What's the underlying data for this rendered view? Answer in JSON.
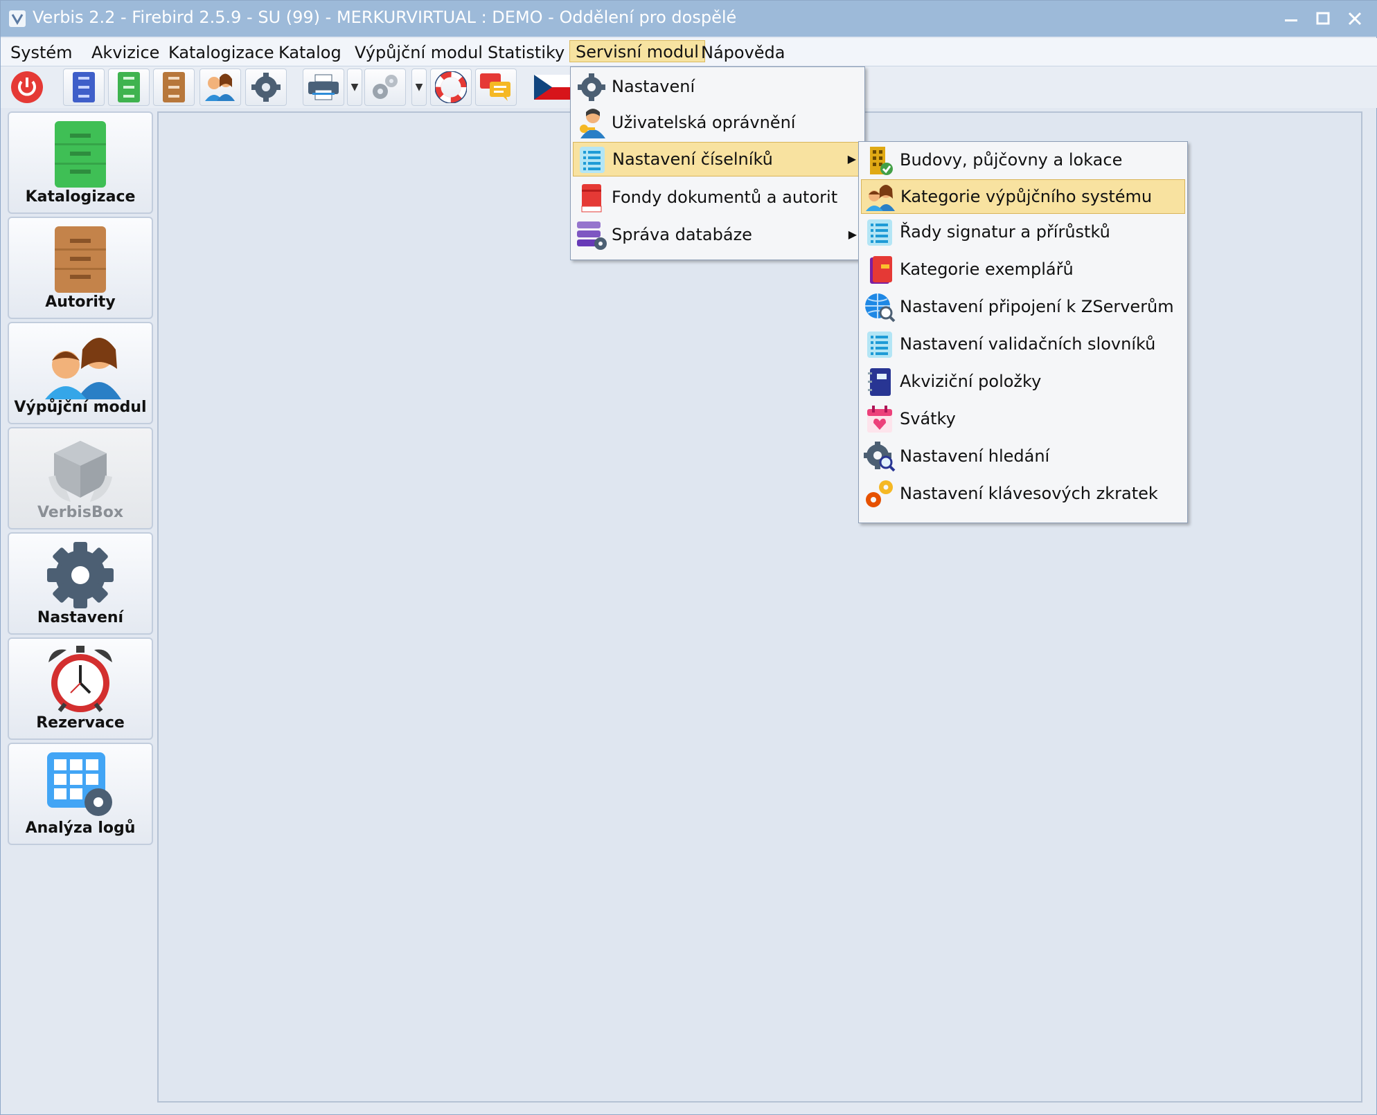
{
  "window": {
    "title": "Verbis 2.2 - Firebird 2.5.9 - SU (99) - MERKURVIRTUAL : DEMO - Oddělení pro dospělé"
  },
  "menubar": [
    {
      "label": "Systém"
    },
    {
      "label": "Akvizice"
    },
    {
      "label": "Katalogizace"
    },
    {
      "label": "Katalog"
    },
    {
      "label": "Výpůjční modul"
    },
    {
      "label": "Statistiky"
    },
    {
      "label": "Servisní modul"
    },
    {
      "label": "Nápověda"
    }
  ],
  "active_menu": "Servisní modul",
  "toolbar": {
    "icons": [
      "power-icon",
      "blue-cabinet-icon",
      "green-cabinet-icon",
      "brown-cabinet-icon",
      "users-icon",
      "gear-icon",
      "printer-icon",
      "gears-icon",
      "lifebuoy-icon",
      "chat-icon",
      "czech-flag-icon"
    ]
  },
  "sidebar": [
    {
      "label": "Katalogizace",
      "icon": "green-cabinet-icon"
    },
    {
      "label": "Autority",
      "icon": "brown-cabinet-icon"
    },
    {
      "label": "Výpůjční modul",
      "icon": "users-icon"
    },
    {
      "label": "VerbisBox",
      "icon": "box-icon",
      "disabled": true
    },
    {
      "label": "Nastavení",
      "icon": "gear-icon"
    },
    {
      "label": "Rezervace",
      "icon": "alarm-clock-icon"
    },
    {
      "label": "Analýza logů",
      "icon": "grid-gear-icon"
    }
  ],
  "servisni_menu": [
    {
      "label": "Nastavení",
      "icon": "gear-icon"
    },
    {
      "label": "Uživatelská oprávnění",
      "icon": "user-key-icon"
    },
    {
      "label": "Nastavení číselníků",
      "icon": "list-icon",
      "submenu": true,
      "highlighted": true
    },
    {
      "label": "Fondy dokumentů a autorit",
      "icon": "red-book-icon"
    },
    {
      "label": "Správa databáze",
      "icon": "database-gear-icon",
      "submenu": true
    }
  ],
  "ciselniky_submenu": [
    {
      "label": "Budovy, půjčovny a lokace",
      "icon": "building-check-icon"
    },
    {
      "label": "Kategorie výpůjčního systému",
      "icon": "users-icon",
      "highlighted": true
    },
    {
      "label": "Řady signatur a přírůstků",
      "icon": "list-icon"
    },
    {
      "label": "Kategorie exemplářů",
      "icon": "books-icon"
    },
    {
      "label": "Nastavení připojení k ZServerům",
      "icon": "globe-search-icon"
    },
    {
      "label": "Nastavení validačních slovníků",
      "icon": "list-icon"
    },
    {
      "label": "Akviziční položky",
      "icon": "notebook-icon"
    },
    {
      "label": "Svátky",
      "icon": "calendar-heart-icon"
    },
    {
      "label": "Nastavení hledání",
      "icon": "gear-search-icon"
    },
    {
      "label": "Nastavení klávesových zkratek",
      "icon": "orange-gears-icon"
    }
  ],
  "colors": {
    "titlebar": "#9dbad9",
    "menu_highlight": "#f8e2a0",
    "panel_bg": "#dfe6f0"
  }
}
